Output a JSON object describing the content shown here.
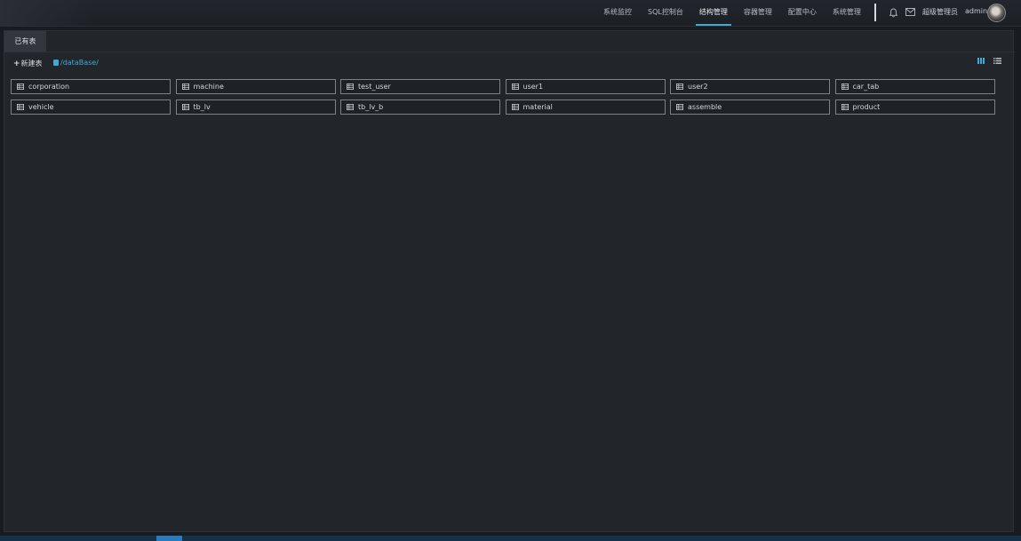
{
  "nav": {
    "items": [
      {
        "label": "系统监控"
      },
      {
        "label": "SQL控制台"
      },
      {
        "label": "结构管理"
      },
      {
        "label": "容器管理"
      },
      {
        "label": "配置中心"
      },
      {
        "label": "系统管理"
      }
    ],
    "active_index": 2
  },
  "user": {
    "role": "超级管理员",
    "name": "admin"
  },
  "icons": {
    "notifications": "bell-icon",
    "messages": "mail-icon",
    "database": "database-icon",
    "table": "table-icon",
    "grid_view": "grid-view-icon",
    "list_view": "list-view-icon"
  },
  "tab": {
    "label": "已有表"
  },
  "toolbar": {
    "new_table_label": "新建表",
    "path": "/dataBase/"
  },
  "tables": [
    {
      "name": "corporation"
    },
    {
      "name": "machine"
    },
    {
      "name": "test_user"
    },
    {
      "name": "user1"
    },
    {
      "name": "user2"
    },
    {
      "name": "car_tab"
    },
    {
      "name": "vehicle"
    },
    {
      "name": "tb_lv"
    },
    {
      "name": "tb_lv_b"
    },
    {
      "name": "material"
    },
    {
      "name": "assemble"
    },
    {
      "name": "product"
    }
  ],
  "colors": {
    "accent": "#3fa9d8",
    "background": "#181b20",
    "panel": "#22262b",
    "card_border": "#7d8289"
  }
}
